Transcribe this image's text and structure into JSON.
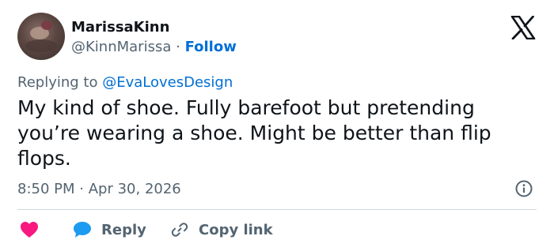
{
  "author": {
    "display_name": "MarissaKinn",
    "handle": "@KinnMarissa",
    "separator": "·",
    "follow_label": "Follow"
  },
  "reply_context": {
    "prefix": "Replying to",
    "mention": "@EvaLovesDesign"
  },
  "tweet": {
    "text": "My kind of shoe. Fully barefoot but pretending you’re wearing a shoe. Might be better than flip flops.",
    "time": "8:50 PM",
    "separator": "·",
    "date": "Apr 30, 2026"
  },
  "actions": {
    "like_icon": "heart-icon",
    "reply_label": "Reply",
    "copy_link_label": "Copy link"
  },
  "colors": {
    "accent": "#006fd6",
    "heart": "#f91880",
    "reply_bubble": "#1d9bf0",
    "muted_text": "#536471"
  },
  "icons": {
    "brand": "x-logo-icon",
    "info": "info-icon",
    "reply": "speech-bubble-icon",
    "copy_link": "link-icon"
  }
}
